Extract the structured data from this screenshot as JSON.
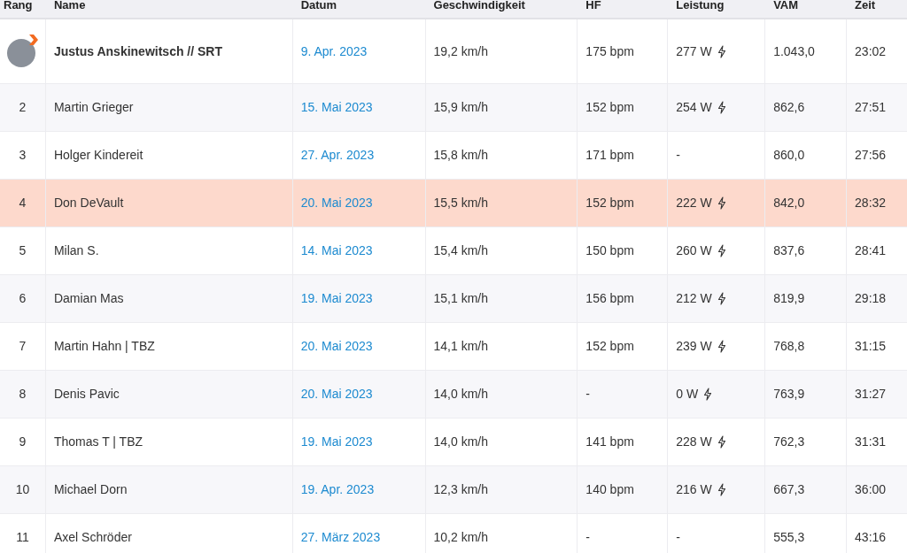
{
  "table": {
    "columns": [
      "Rang",
      "Name",
      "Datum",
      "Geschwindigkeit",
      "HF",
      "Leistung",
      "VAM",
      "Zeit"
    ],
    "rows": [
      {
        "kind": "avatar",
        "name": "Justus Anskinewitsch // SRT",
        "date": "9. Apr. 2023",
        "speed": "19,2 km/h",
        "hr": "175 bpm",
        "power": "277 W",
        "power_icon": true,
        "vam": "1.043,0",
        "time": "23:02",
        "highlighted": false
      },
      {
        "kind": "rank",
        "rank": "2",
        "name": "Martin Grieger",
        "date": "15. Mai 2023",
        "speed": "15,9 km/h",
        "hr": "152 bpm",
        "power": "254 W",
        "power_icon": true,
        "vam": "862,6",
        "time": "27:51",
        "highlighted": false
      },
      {
        "kind": "rank",
        "rank": "3",
        "name": "Holger Kindereit",
        "date": "27. Apr. 2023",
        "speed": "15,8 km/h",
        "hr": "171 bpm",
        "power": "-",
        "power_icon": false,
        "vam": "860,0",
        "time": "27:56",
        "highlighted": false
      },
      {
        "kind": "rank",
        "rank": "4",
        "name": "Don DeVault",
        "date": "20. Mai 2023",
        "speed": "15,5 km/h",
        "hr": "152 bpm",
        "power": "222 W",
        "power_icon": true,
        "vam": "842,0",
        "time": "28:32",
        "highlighted": true
      },
      {
        "kind": "rank",
        "rank": "5",
        "name": "Milan S.",
        "date": "14. Mai 2023",
        "speed": "15,4 km/h",
        "hr": "150 bpm",
        "power": "260 W",
        "power_icon": true,
        "vam": "837,6",
        "time": "28:41",
        "highlighted": false
      },
      {
        "kind": "rank",
        "rank": "6",
        "name": "Damian Mas",
        "date": "19. Mai 2023",
        "speed": "15,1 km/h",
        "hr": "156 bpm",
        "power": "212 W",
        "power_icon": true,
        "vam": "819,9",
        "time": "29:18",
        "highlighted": false
      },
      {
        "kind": "rank",
        "rank": "7",
        "name": "Martin Hahn | TBZ",
        "date": "20. Mai 2023",
        "speed": "14,1 km/h",
        "hr": "152 bpm",
        "power": "239 W",
        "power_icon": true,
        "vam": "768,8",
        "time": "31:15",
        "highlighted": false
      },
      {
        "kind": "rank",
        "rank": "8",
        "name": "Denis Pavic",
        "date": "20. Mai 2023",
        "speed": "14,0 km/h",
        "hr": "-",
        "power": "0 W",
        "power_icon": true,
        "vam": "763,9",
        "time": "31:27",
        "highlighted": false
      },
      {
        "kind": "rank",
        "rank": "9",
        "name": "Thomas T | TBZ",
        "date": "19. Mai 2023",
        "speed": "14,0 km/h",
        "hr": "141 bpm",
        "power": "228 W",
        "power_icon": true,
        "vam": "762,3",
        "time": "31:31",
        "highlighted": false
      },
      {
        "kind": "rank",
        "rank": "10",
        "name": "Michael Dorn",
        "date": "19. Apr. 2023",
        "speed": "12,3 km/h",
        "hr": "140 bpm",
        "power": "216 W",
        "power_icon": true,
        "vam": "667,3",
        "time": "36:00",
        "highlighted": false
      },
      {
        "kind": "rank",
        "rank": "11",
        "name": "Axel Schröder",
        "date": "27. März 2023",
        "speed": "10,2 km/h",
        "hr": "-",
        "power": "-",
        "power_icon": false,
        "vam": "555,3",
        "time": "43:16",
        "highlighted": false
      }
    ]
  }
}
